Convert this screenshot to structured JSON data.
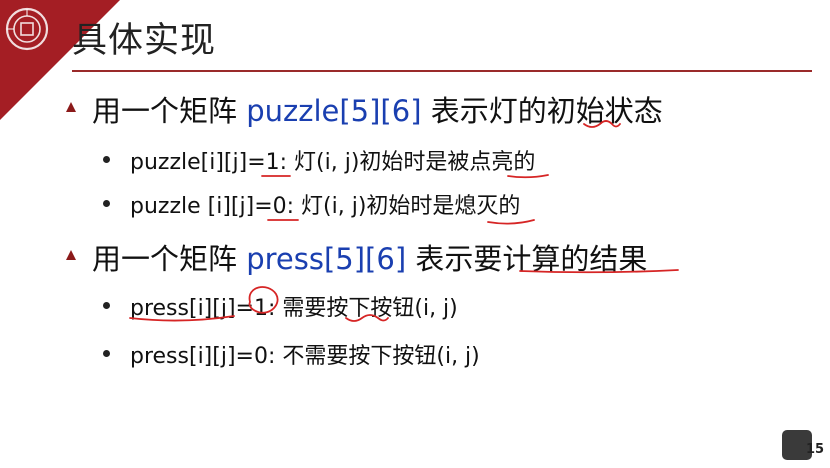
{
  "colors": {
    "accent": "#a41e24",
    "highlight_text": "#1a3fb0",
    "annotation_ink": "#d62525"
  },
  "slide": {
    "title": "具体实现",
    "page_number": "15",
    "items": [
      {
        "prefix": "用一个矩阵 ",
        "highlight": "puzzle[5][6]",
        "suffix": " 表示灯的初始状态",
        "subitems": [
          "puzzle[i][j]=1: 灯(i, j)初始时是被点亮的",
          "puzzle [i][j]=0: 灯(i, j)初始时是熄灭的"
        ]
      },
      {
        "prefix": "用一个矩阵 ",
        "highlight": "press[5][6]",
        "suffix": " 表示要计算的结果",
        "subitems": [
          "press[i][j]=1: 需要按下按钮(i, j)",
          "press[i][j]=0: 不需要按下按钮(i, j)"
        ]
      }
    ]
  }
}
